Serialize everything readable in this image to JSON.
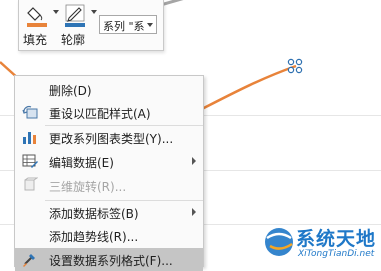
{
  "toolbar": {
    "fill_label": "填充",
    "outline_label": "轮廓",
    "series_value": "系列 \"系"
  },
  "menu": {
    "items": [
      {
        "label": "删除(D)"
      },
      {
        "label": "重设以匹配样式(A)"
      },
      {
        "label": "更改系列图表类型(Y)..."
      },
      {
        "label": "编辑数据(E)"
      },
      {
        "label": "三维旋转(R)..."
      },
      {
        "label": "添加数据标签(B)"
      },
      {
        "label": "添加趋势线(R)..."
      },
      {
        "label": "设置数据系列格式(F)..."
      }
    ]
  },
  "watermark": {
    "text": "系统天地",
    "url": "XiTongTianDi.net"
  },
  "colors": {
    "series_line": "#e8833a",
    "other_series": "#a5a5a5",
    "accent": "#1f78c8",
    "highlight": "#c5c5c5"
  }
}
